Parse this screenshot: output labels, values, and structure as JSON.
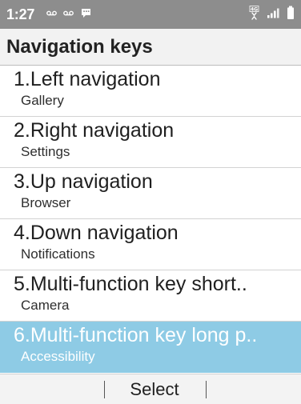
{
  "status_bar": {
    "time": "1:27",
    "network": "4G",
    "left_icons": [
      "voicemail-icon",
      "voicemail-icon",
      "message-icon"
    ],
    "right_icons": [
      "network-4g-icon",
      "signal-icon",
      "battery-icon"
    ]
  },
  "header": {
    "title": "Navigation keys"
  },
  "items": [
    {
      "title": "1.Left navigation",
      "subtitle": "Gallery"
    },
    {
      "title": "2.Right navigation",
      "subtitle": "Settings"
    },
    {
      "title": "3.Up navigation",
      "subtitle": "Browser"
    },
    {
      "title": "4.Down navigation",
      "subtitle": "Notifications"
    },
    {
      "title": "5.Multi-function key short..",
      "subtitle": "Camera"
    },
    {
      "title": "6.Multi-function key long p..",
      "subtitle": "Accessibility",
      "selected": true
    }
  ],
  "softkeys": {
    "left": "",
    "center": "Select",
    "right": ""
  },
  "colors": {
    "status_bar": "#8d8d8d",
    "header_background": "#f2f2f2",
    "selected_background": "#8ecbe5",
    "selected_text": "#ffffff",
    "softkey_background": "#f3f3f3"
  }
}
